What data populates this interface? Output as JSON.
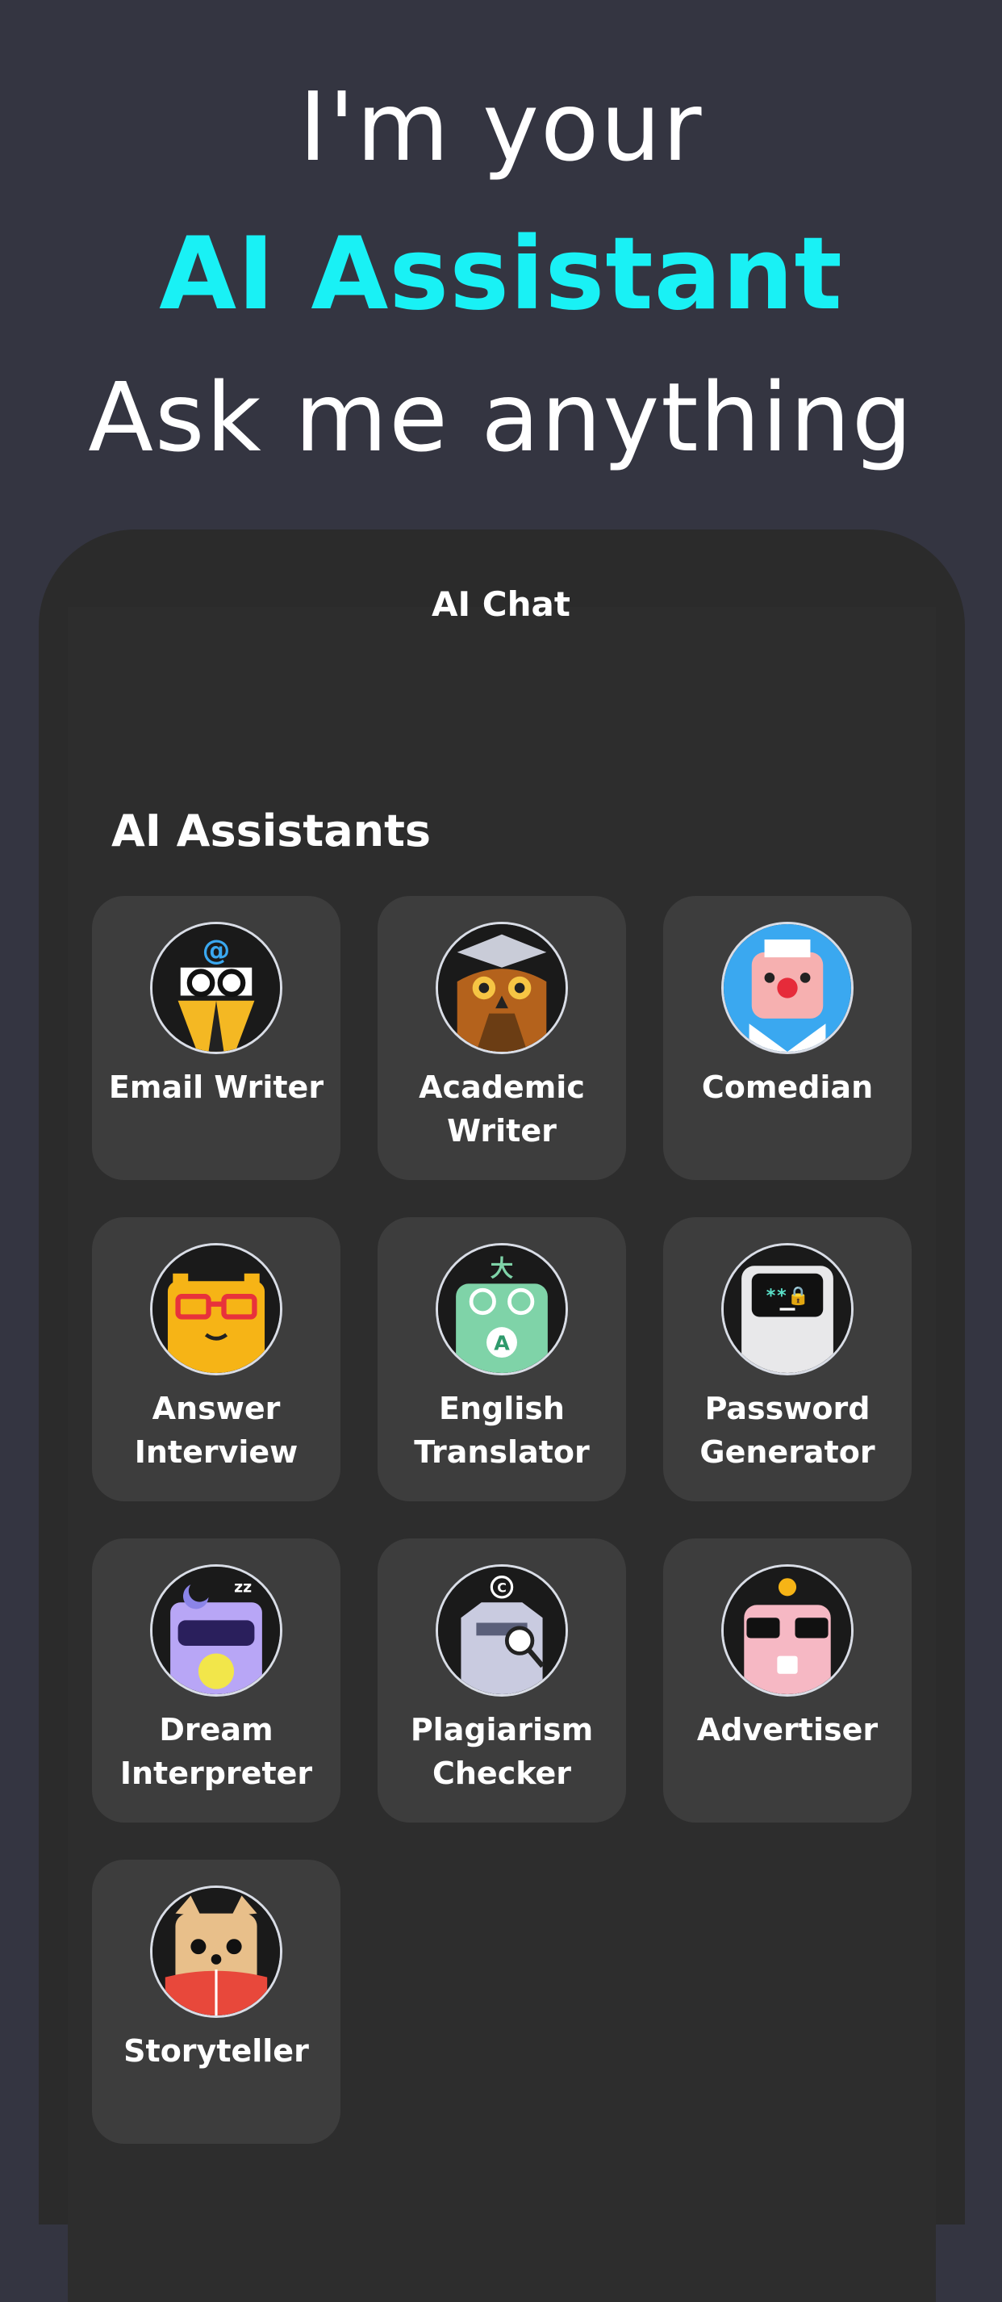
{
  "hero": {
    "line1": "I'm your",
    "line2": "AI Assistant",
    "line3": "Ask me anything"
  },
  "app": {
    "title": "AI Chat",
    "section_title": "AI Assistants"
  },
  "assistants": [
    {
      "label_line1": "Email Writer",
      "label_line2": "",
      "icon": "email-writer-icon"
    },
    {
      "label_line1": "Academic",
      "label_line2": "Writer",
      "icon": "academic-writer-icon"
    },
    {
      "label_line1": "Comedian",
      "label_line2": "",
      "icon": "comedian-icon"
    },
    {
      "label_line1": "Answer",
      "label_line2": "Interview",
      "icon": "answer-interview-icon"
    },
    {
      "label_line1": "English",
      "label_line2": "Translator",
      "icon": "english-translator-icon"
    },
    {
      "label_line1": "Password",
      "label_line2": "Generator",
      "icon": "password-generator-icon"
    },
    {
      "label_line1": "Dream",
      "label_line2": "Interpreter",
      "icon": "dream-interpreter-icon"
    },
    {
      "label_line1": "Plagiarism",
      "label_line2": "Checker",
      "icon": "plagiarism-checker-icon"
    },
    {
      "label_line1": "Advertiser",
      "label_line2": "",
      "icon": "advertiser-icon"
    },
    {
      "label_line1": "Storyteller",
      "label_line2": "",
      "icon": "storyteller-icon"
    }
  ],
  "colors": {
    "background": "#343541",
    "accent": "#19f1f5",
    "card": "#3d3d3d"
  }
}
